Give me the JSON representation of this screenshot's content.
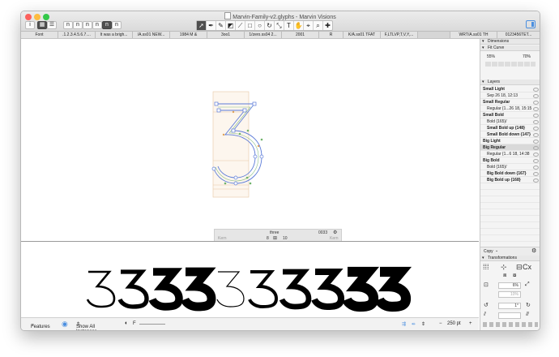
{
  "window": {
    "title": "Marvin-Family-v2.glyphs - Marvin Visions",
    "colors": {
      "close": "#fc605c",
      "minimize": "#fdbc40",
      "zoom": "#34c84a",
      "accent": "#4a8fe0",
      "node_blue": "#5b7bd8",
      "node_green": "#6fb36a",
      "node_orange": "#e0a35a"
    }
  },
  "toolbar": {
    "info_icon": "info-icon",
    "view_modes": [
      "grid-view-icon",
      "list-view-icon"
    ],
    "glyph_views": [
      "n",
      "n",
      "n",
      "n",
      "n",
      "n"
    ],
    "tools": [
      "select-icon",
      "pen-icon",
      "pencil-icon",
      "eraser-icon",
      "knife-icon",
      "rectangle-icon",
      "ellipse-icon",
      "rotate-icon",
      "scale-icon",
      "text-icon",
      "hand-icon",
      "measure-icon",
      "zoom-icon",
      "annotation-icon"
    ]
  },
  "tabs": [
    "Font",
    ".1.2.3.4.5.6.7....",
    "It was a brigh...",
    "/A.ss01 NEW...",
    "1984 M &",
    "3oo1",
    "1/zero.ss04 2...",
    "2001",
    "R",
    "K/A.ss01 TFAT",
    "F,LTLVP,T,V,Y,...",
    "",
    "WRT/A.ss01 TH",
    "0123456TET..."
  ],
  "metrics": {
    "glyph_name": "three",
    "unicode": "0033",
    "lsb": "8",
    "rsb": "10",
    "left_kern_group": "three",
    "width": "523",
    "right_kern_group": "three",
    "kern_left_label": "Kern",
    "kern_right_label": "Kern"
  },
  "preview": {
    "text": "3333333333",
    "weights": [
      200,
      400,
      700,
      800,
      100,
      300,
      500,
      600,
      900,
      900
    ]
  },
  "bottombar": {
    "features_label": "Features",
    "instances_label": "Show All Instances",
    "f_label": "F",
    "zoom_value": "250 pt"
  },
  "panel": {
    "dimensions_label": "Dimensions",
    "fit_curve_label": "Fit Curve",
    "fit_min": "55%",
    "fit_max": "70%",
    "layers_label": "Layers",
    "layers": [
      {
        "name": "Small Light",
        "type": "master"
      },
      {
        "name": "Sep 26 18, 12:13",
        "type": "layer"
      },
      {
        "name": "Small Regular",
        "type": "master"
      },
      {
        "name": "Regular {1...26 18, 15:15",
        "type": "layer"
      },
      {
        "name": "Small Bold",
        "type": "master"
      },
      {
        "name": "Bold {165}/",
        "type": "layer"
      },
      {
        "name": "Small Bold up {148}",
        "type": "brace"
      },
      {
        "name": "Small Bold down {147}",
        "type": "brace"
      },
      {
        "name": "Big Light",
        "type": "master"
      },
      {
        "name": "Big Regular",
        "type": "master-selected"
      },
      {
        "name": "Regular {1...6 18, 14:38",
        "type": "layer"
      },
      {
        "name": "Big Bold",
        "type": "master"
      },
      {
        "name": "Bold {165}/",
        "type": "layer"
      },
      {
        "name": "Big Bold down {167}",
        "type": "brace"
      },
      {
        "name": "Big Bold up {168}",
        "type": "brace"
      }
    ],
    "copy_label": "Copy",
    "transformations_label": "Transformations",
    "scale_value": "6%",
    "scale_value2": "10%",
    "rotate_value": "1°",
    "cx_label": "Cx"
  }
}
